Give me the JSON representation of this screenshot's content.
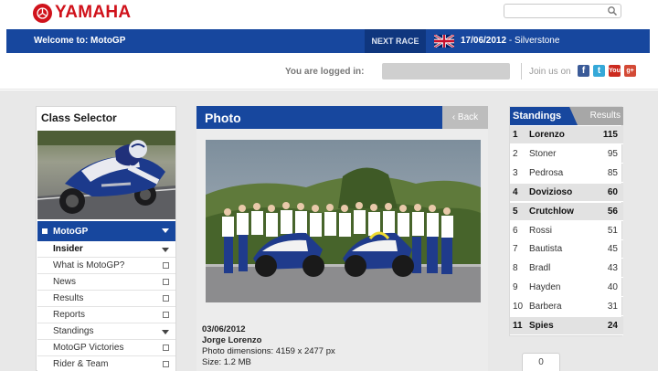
{
  "brand": {
    "name": "YAMAHA",
    "color": "#d0121b",
    "icon": "tuning-forks-icon"
  },
  "search": {
    "placeholder": "",
    "value": "",
    "icon": "magnifier-icon"
  },
  "header": {
    "welcome": "Welcome to: MotoGP",
    "next_race_label": "NEXT RACE",
    "race_flag": "uk-flag-icon",
    "race_date": "17/06/2012",
    "race_place": "- Silverstone"
  },
  "login": {
    "label": "You are logged in:",
    "join_label": "Join us on",
    "social": [
      {
        "name": "facebook-icon",
        "glyph": "f"
      },
      {
        "name": "twitter-icon",
        "glyph": "t"
      },
      {
        "name": "youtube-icon",
        "glyph": "You"
      },
      {
        "name": "googleplus-icon",
        "glyph": "g+"
      }
    ]
  },
  "class_selector": {
    "title": "Class Selector",
    "menu_head": "MotoGP",
    "items": [
      {
        "label": "Insider",
        "type": "dropdown",
        "active": true
      },
      {
        "label": "What is MotoGP?",
        "type": "plus"
      },
      {
        "label": "News",
        "type": "plus"
      },
      {
        "label": "Results",
        "type": "plus"
      },
      {
        "label": "Reports",
        "type": "plus"
      },
      {
        "label": "Standings",
        "type": "dropdown"
      },
      {
        "label": "MotoGP Victories",
        "type": "plus"
      },
      {
        "label": "Rider & Team",
        "type": "plus"
      }
    ]
  },
  "photo": {
    "title": "Photo",
    "back_label": "‹ Back",
    "date": "03/06/2012",
    "name": "Jorge Lorenzo",
    "dimensions": "Photo dimensions: 4159 x 2477 px",
    "size": "Size: 1.2 MB"
  },
  "standings": {
    "tab_active": "Standings",
    "tab_other": "Results",
    "rows": [
      {
        "pos": "1",
        "name": "Lorenzo",
        "pts": "115",
        "hl": true
      },
      {
        "pos": "2",
        "name": "Stoner",
        "pts": "95",
        "hl": false
      },
      {
        "pos": "3",
        "name": "Pedrosa",
        "pts": "85",
        "hl": false
      },
      {
        "pos": "4",
        "name": "Dovizioso",
        "pts": "60",
        "hl": true
      },
      {
        "pos": "5",
        "name": "Crutchlow",
        "pts": "56",
        "hl": true
      },
      {
        "pos": "6",
        "name": "Rossi",
        "pts": "51",
        "hl": false
      },
      {
        "pos": "7",
        "name": "Bautista",
        "pts": "45",
        "hl": false
      },
      {
        "pos": "8",
        "name": "Bradl",
        "pts": "43",
        "hl": false
      },
      {
        "pos": "9",
        "name": "Hayden",
        "pts": "40",
        "hl": false
      },
      {
        "pos": "10",
        "name": "Barbera",
        "pts": "31",
        "hl": false
      },
      {
        "pos": "11",
        "name": "Spies",
        "pts": "24",
        "hl": true
      }
    ]
  },
  "counter": {
    "value": "0"
  },
  "colors": {
    "primary_blue": "#17479e",
    "dark_blue": "#0f367e",
    "brand_red": "#d0121b"
  }
}
